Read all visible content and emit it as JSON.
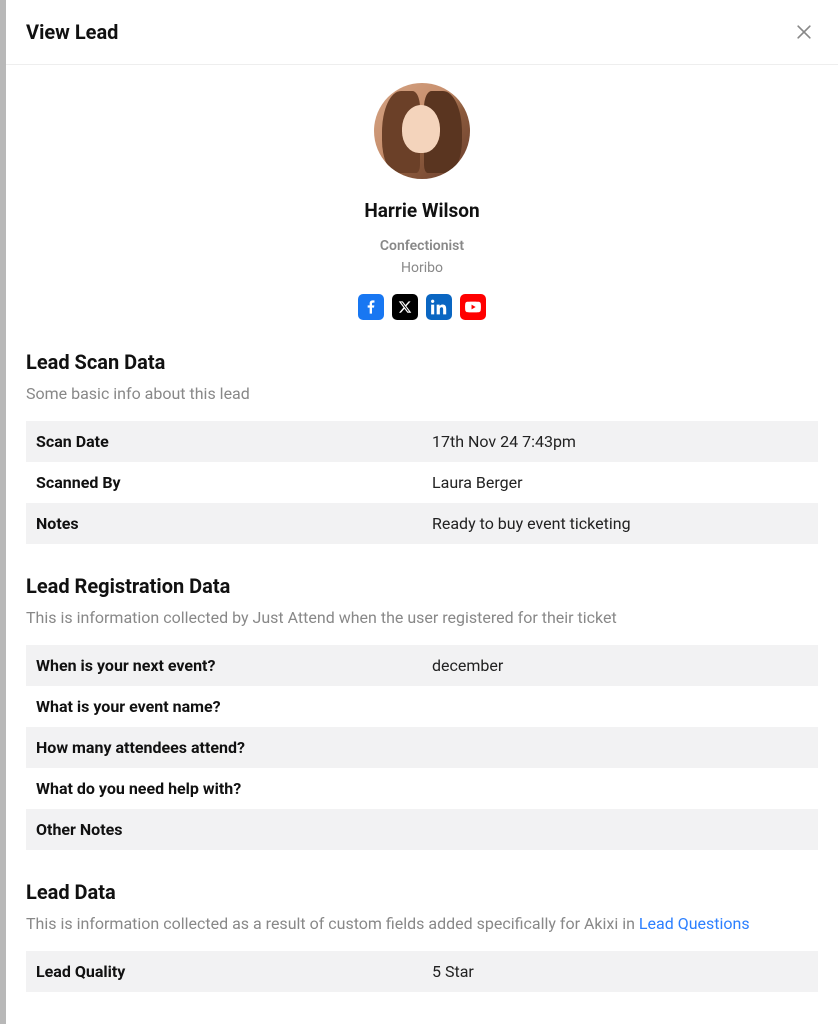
{
  "modal": {
    "title": "View Lead"
  },
  "profile": {
    "name": "Harrie Wilson",
    "role": "Confectionist",
    "company": "Horibo"
  },
  "socials": {
    "facebook": "facebook-icon",
    "x": "x-icon",
    "linkedin": "linkedin-icon",
    "youtube": "youtube-icon"
  },
  "sections": {
    "scan": {
      "heading": "Lead Scan Data",
      "sub": "Some basic info about this lead",
      "rows": [
        {
          "label": "Scan Date",
          "value": "17th Nov 24 7:43pm"
        },
        {
          "label": "Scanned By",
          "value": "Laura Berger"
        },
        {
          "label": "Notes",
          "value": "Ready to buy event ticketing"
        }
      ]
    },
    "registration": {
      "heading": "Lead Registration Data",
      "sub": "This is information collected by Just Attend when the user registered for their ticket",
      "rows": [
        {
          "label": "When is your next event?",
          "value": "december"
        },
        {
          "label": "What is your event name?",
          "value": ""
        },
        {
          "label": "How many attendees attend?",
          "value": ""
        },
        {
          "label": "What do you need help with?",
          "value": ""
        },
        {
          "label": "Other Notes",
          "value": ""
        }
      ]
    },
    "leaddata": {
      "heading": "Lead Data",
      "sub_prefix": "This is information collected as a result of custom fields added specifically for Akixi in ",
      "sub_link": "Lead Questions",
      "rows": [
        {
          "label": "Lead Quality",
          "value": "5 Star"
        }
      ]
    }
  }
}
